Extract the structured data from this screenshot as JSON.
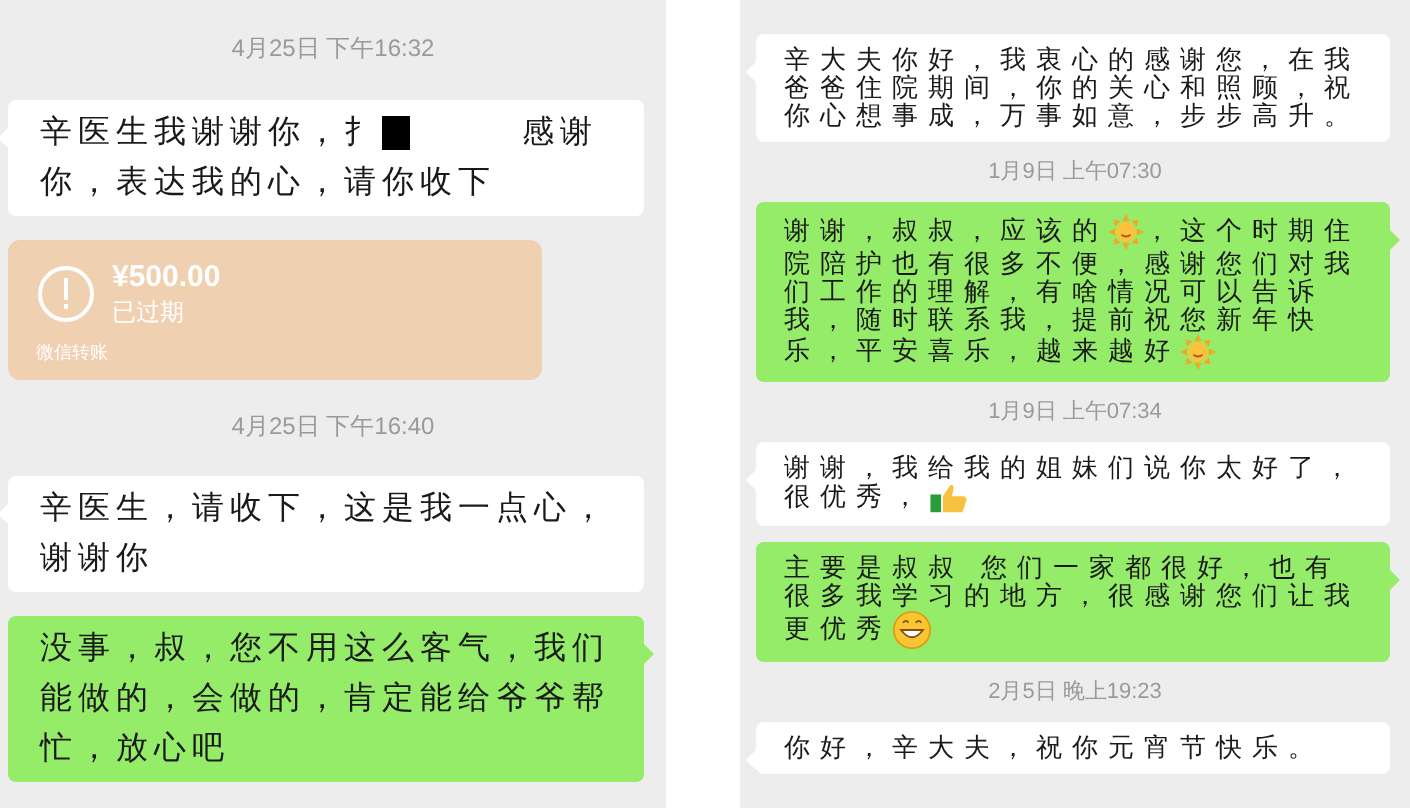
{
  "panels": [
    {
      "items": [
        {
          "kind": "time",
          "text": "4月25日 下午16:32"
        },
        {
          "kind": "received",
          "segments": [
            {
              "kind": "text",
              "text": "辛医生我谢谢你，扌"
            },
            {
              "kind": "redaction"
            },
            {
              "kind": "text",
              "text": "感谢你，表达我的心，请你收下"
            }
          ]
        },
        {
          "kind": "transfer",
          "amount": "¥500.00",
          "status": "已过期",
          "label": "微信转账"
        },
        {
          "kind": "time",
          "text": "4月25日 下午16:40"
        },
        {
          "kind": "received",
          "segments": [
            {
              "kind": "text",
              "text": "辛医生，请收下，这是我一点心，谢谢你"
            }
          ]
        },
        {
          "kind": "sent",
          "segments": [
            {
              "kind": "text",
              "text": "没事，叔，您不用这么客气，我们能做的，会做的，肯定能给爷爷帮忙，放心吧"
            }
          ]
        }
      ]
    },
    {
      "items": [
        {
          "kind": "received",
          "segments": [
            {
              "kind": "text",
              "text": "辛大夫你好，我衷心的感谢您，在我爸爸住院期间，你的关心和照顾，祝你心想事成，万事如意，步步高升。"
            }
          ]
        },
        {
          "kind": "time",
          "text": "1月9日 上午07:30"
        },
        {
          "kind": "sent",
          "segments": [
            {
              "kind": "text",
              "text": "谢谢，叔叔，应该的"
            },
            {
              "kind": "sun"
            },
            {
              "kind": "text",
              "text": "，这个时期住院陪护也有很多不便，感谢您们对我们工作的理解，有啥情况可以告诉我，随时联系我，提前祝您新年快乐，平安喜乐，越来越好"
            },
            {
              "kind": "sun"
            }
          ]
        },
        {
          "kind": "time",
          "text": "1月9日 上午07:34"
        },
        {
          "kind": "received",
          "segments": [
            {
              "kind": "text",
              "text": "谢谢，我给我的姐妹们说你太好了，很优秀，"
            },
            {
              "kind": "thumbs"
            }
          ]
        },
        {
          "kind": "sent",
          "segments": [
            {
              "kind": "text",
              "text": "主要是叔叔 您们一家都很好，也有很多我学习的地方，很感谢您们让我更优秀"
            },
            {
              "kind": "grin"
            }
          ]
        },
        {
          "kind": "time",
          "text": "2月5日 晚上19:23"
        },
        {
          "kind": "received",
          "segments": [
            {
              "kind": "text",
              "text": "你好，辛大夫，祝你元宵节快乐。"
            }
          ]
        }
      ]
    }
  ]
}
